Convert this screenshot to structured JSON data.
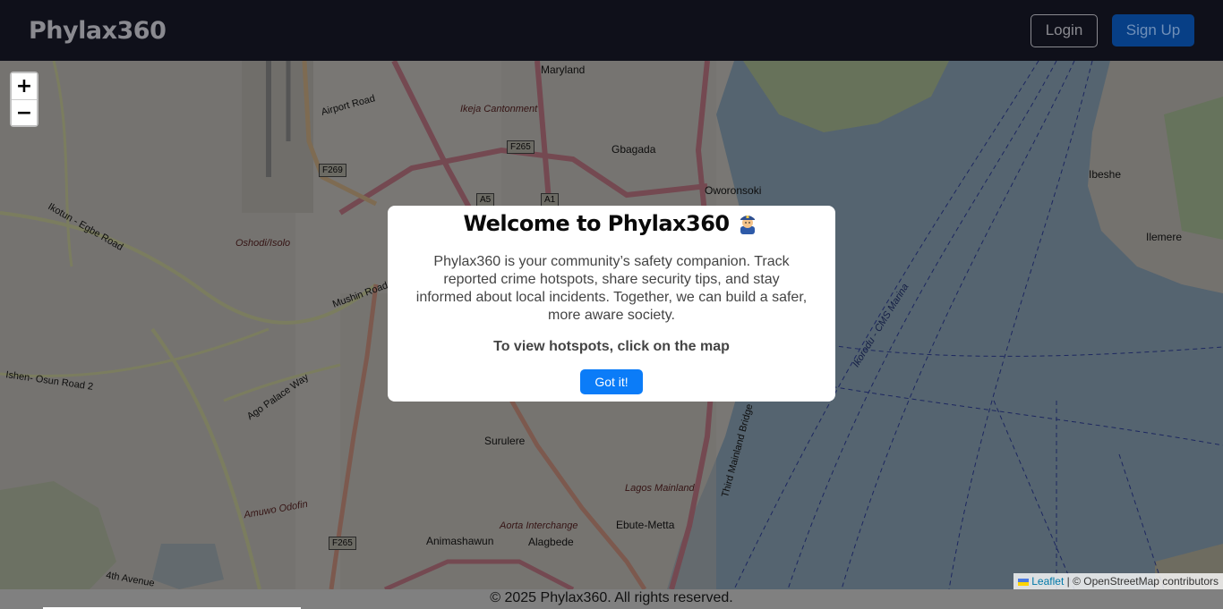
{
  "navbar": {
    "brand": "Phylax360",
    "login_label": "Login",
    "signup_label": "Sign Up"
  },
  "map": {
    "zoom_in": "+",
    "zoom_out": "−",
    "attribution_link": "Leaflet",
    "attribution_text": "| © OpenStreetMap contributors",
    "labels": {
      "maryland": "Maryland",
      "ikeja_cantonment": "Ikeja Cantonment",
      "gbagada": "Gbagada",
      "oworonsoki": "Oworonsoki",
      "ibeshe": "Ibeshe",
      "ilemere": "Ilemere",
      "oshodi_isolo": "Oshodi/Isolo",
      "surulere": "Surulere",
      "lagos_mainland": "Lagos Mainland",
      "aorta_interchange": "Aorta Interchange",
      "ebute_metta": "Ebute-Metta",
      "animashawun": "Animashawun",
      "alagbede": "Alagbede",
      "amuwo_odofin": "Amuwo Odofin",
      "ikorodu_cms": "Ikorodu - CMS Marina",
      "mushin_road": "Mushin Road",
      "airport_road": "Airport Road",
      "ikotun_egbe": "Ikotun - Egbe Road",
      "ishen_osun": "Ishen- Osun Road 2",
      "ago_palace_way": "Ago Palace Way",
      "third_mainland": "Third Mainland Bridge",
      "fourth_avenue": "4th Avenue",
      "f265": "F265",
      "f269": "F269",
      "a5": "A5",
      "a1": "A1",
      "f265b": "F265"
    }
  },
  "modal": {
    "title": "Welcome to Phylax360",
    "emoji_icon": "police-officer-icon",
    "body": "Phylax360 is your community’s safety companion. Track reported crime hotspots, share security tips, and stay informed about local incidents. Together, we can build a safer, more aware society.",
    "hint": "To view hotspots, click on the map",
    "button_label": "Got it!"
  },
  "footer": {
    "text": "© 2025 Phylax360. All rights reserved."
  },
  "colors": {
    "navbar_bg": "#0f101a",
    "signup_bg": "#073f86",
    "got_it_bg": "#0b7cf8",
    "water": "#aac8e0",
    "land": "#f2efe9"
  }
}
